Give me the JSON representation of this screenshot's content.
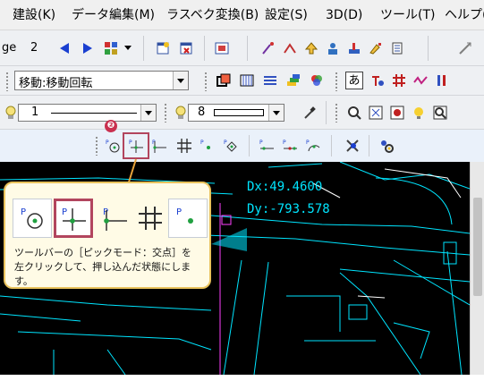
{
  "menubar": {
    "items": [
      {
        "label": "建設(K)"
      },
      {
        "label": "データ編集(M)"
      },
      {
        "label": "ラスベク変換(B)"
      },
      {
        "label": "設定(S)"
      },
      {
        "label": "3D(D)"
      },
      {
        "label": "ツール(T)"
      },
      {
        "label": "ヘルプ("
      }
    ]
  },
  "toolbar1": {
    "page_label": "ge",
    "page_number": "2"
  },
  "toolbar2": {
    "command_select": "移動:移動回転",
    "text_icon": "あ"
  },
  "toolbar3": {
    "layer_number": "1",
    "pen_number": "8"
  },
  "callout": {
    "badge": "❷",
    "text_line1": "ツールバーの［ピックモード：交点］を",
    "text_line2": "左クリックして、押し込んだ状態にします。"
  },
  "canvas": {
    "dx_text": "Dx:49.4600",
    "dy_text": "Dy:-793.578"
  },
  "colors": {
    "canvas_bg": "#000000",
    "cad_line": "#00e5ff",
    "highlight": "#b2455e",
    "callout_border": "#e9c25b",
    "callout_bg": "#fffbe6",
    "badge": "#c9304f"
  }
}
